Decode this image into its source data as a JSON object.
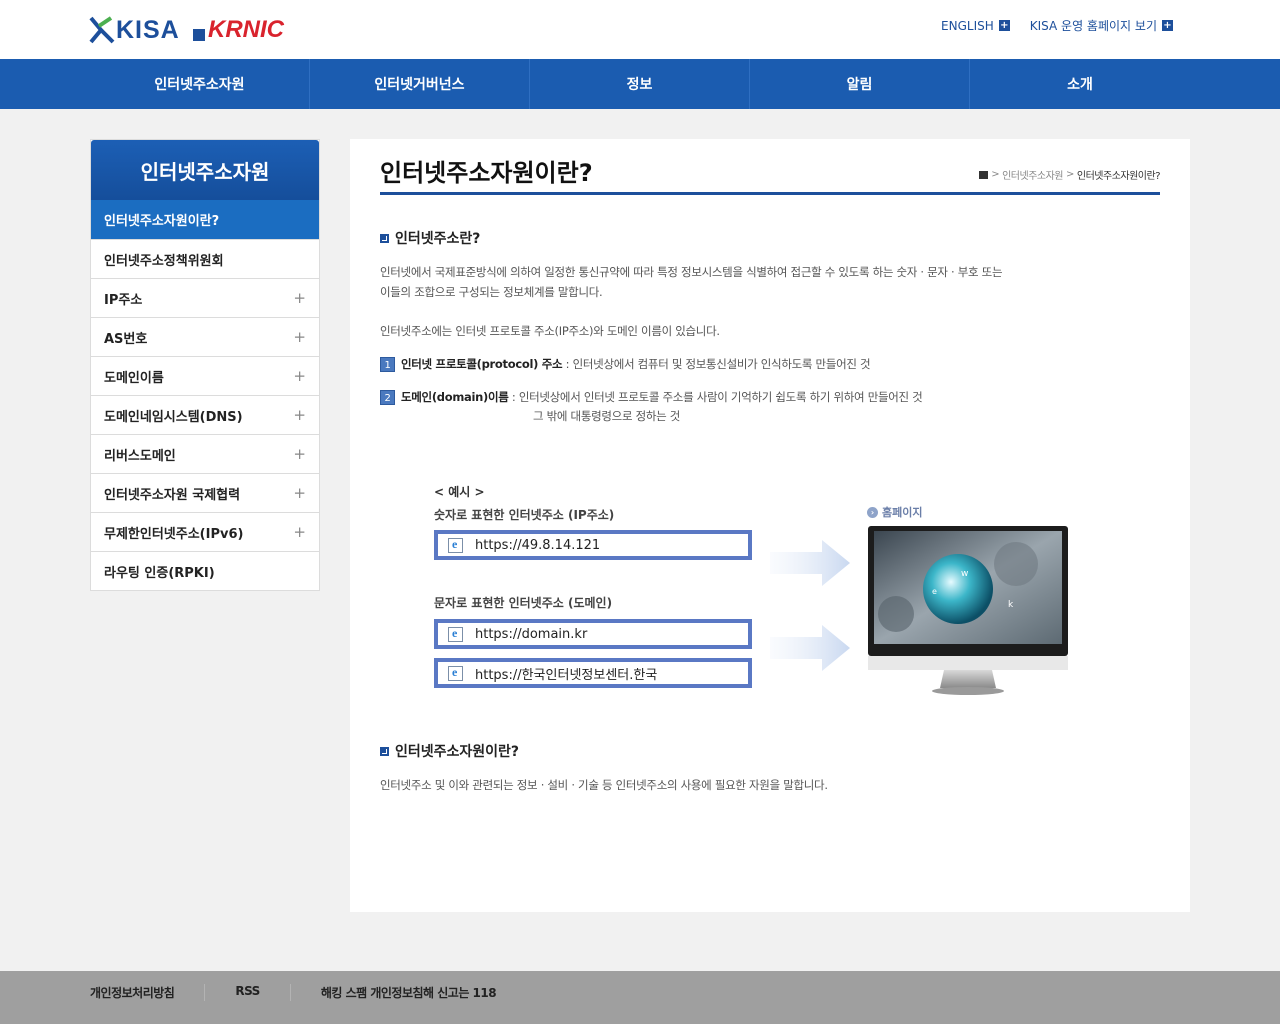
{
  "header": {
    "logo_kisa": "KISA",
    "logo_krnic": "KRNIC",
    "links": [
      {
        "label": "ENGLISH"
      },
      {
        "label": "KISA 운영 홈페이지 보기"
      }
    ]
  },
  "gnb": [
    "인터넷주소자원",
    "인터넷거버넌스",
    "정보",
    "알림",
    "소개"
  ],
  "lnb": {
    "title": "인터넷주소자원",
    "items": [
      {
        "label": "인터넷주소자원이란?",
        "plus": ""
      },
      {
        "label": "인터넷주소정책위원회",
        "plus": ""
      },
      {
        "label": "IP주소",
        "plus": "+"
      },
      {
        "label": "AS번호",
        "plus": "+"
      },
      {
        "label": "도메인이름",
        "plus": "+"
      },
      {
        "label": "도메인네임시스템(DNS)",
        "plus": "+"
      },
      {
        "label": "리버스도메인",
        "plus": "+"
      },
      {
        "label": "인터넷주소자원 국제협력",
        "plus": "+"
      },
      {
        "label": "무제한인터넷주소(IPv6)",
        "plus": "+"
      },
      {
        "label": "라우팅 인증(RPKI)",
        "plus": ""
      }
    ]
  },
  "content": {
    "title": "인터넷주소자원이란?",
    "breadcrumb": [
      "인터넷주소자원",
      "인터넷주소자원이란?"
    ],
    "sec1_title": "인터넷주소란?",
    "sec1_p1_line1": "인터넷에서 국제표준방식에 의하여 일정한 통신규약에 따라 특정 정보시스템을 식별하여 접근할 수 있도록 하는 숫자 · 문자 · 부호 또는",
    "sec1_p1_line2": "이들의 조합으로 구성되는 정보체계를 말합니다.",
    "sec1_p2": "인터넷주소에는 인터넷 프로토콜 주소(IP주소)와 도메인 이름이 있습니다.",
    "item1_num": "1",
    "item1_term": "인터넷 프로토콜(protocol) 주소",
    "item1_desc": " : 인터넷상에서 컴퓨터 및 정보통신설비가 인식하도록 만들어진 것",
    "item2_num": "2",
    "item2_term": "도메인(domain)이름",
    "item2_desc": " : 인터넷상에서 인터넷 프로토콜 주소를 사람이 기억하기 쉽도록 하기 위하여 만들어진 것",
    "item2_desc2": "그 밖에 대통령령으로 정하는 것",
    "example": {
      "label": "< 예시 >",
      "numeric_title": "숫자로 표현한 인터넷주소 (IP주소)",
      "numeric_url": "https://49.8.14.121",
      "text_title": "문자로 표현한 인터넷주소 (도메인)",
      "text_url1": "https://domain.kr",
      "text_url2": "https://한국인터넷정보센터.한국",
      "homepage_label": "홈페이지"
    },
    "sec2_title": "인터넷주소자원이란?",
    "sec2_p": "인터넷주소 및 이와 관련되는 정보 · 설비 · 기술 등 인터넷주소의 사용에 필요한 자원을 말합니다."
  },
  "footer": {
    "links": [
      "개인정보처리방침",
      "RSS",
      "해킹 스팸 개인정보침해 신고는 118"
    ]
  }
}
